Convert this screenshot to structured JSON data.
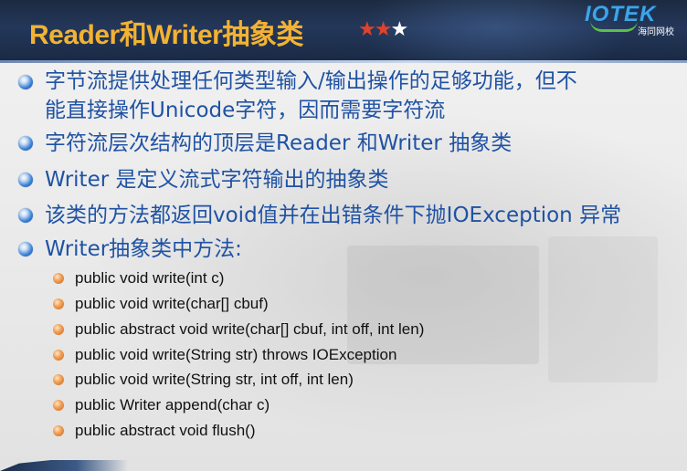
{
  "header": {
    "title": "Reader和Writer抽象类",
    "stars": {
      "filled": 2,
      "total": 3,
      "filled_char": "★",
      "empty_char": "★"
    },
    "logo": {
      "text": "IOTEK",
      "subtitle": "海同网校"
    },
    "colors": {
      "title": "#f2b233",
      "star_filled": "#e0422a",
      "star_empty": "#ffffff",
      "logo": "#3fa4e6"
    }
  },
  "content": {
    "items": [
      {
        "lines": [
          "字节流提供处理任何类型输入/输出操作的足够功能，但不",
          "能直接操作Unicode字符，因而需要字符流"
        ]
      },
      {
        "lines": [
          "字符流层次结构的顶层是Reader 和Writer 抽象类"
        ]
      },
      {
        "lines": [
          "Writer 是定义流式字符输出的抽象类"
        ]
      },
      {
        "lines": [
          "该类的方法都返回void值并在出错条件下抛IOException 异常"
        ]
      },
      {
        "lines": [
          "Writer抽象类中方法:"
        ]
      }
    ],
    "methods": [
      "public void write(int c)",
      "public void write(char[] cbuf)",
      "public abstract void write(char[] cbuf, int off, int len)",
      "public void write(String str) throws IOException",
      "public void write(String str, int off, int len)",
      "public Writer append(char c)",
      "public abstract void flush()"
    ],
    "colors": {
      "item_text": "#1f52a4",
      "method_text": "#111111"
    }
  }
}
